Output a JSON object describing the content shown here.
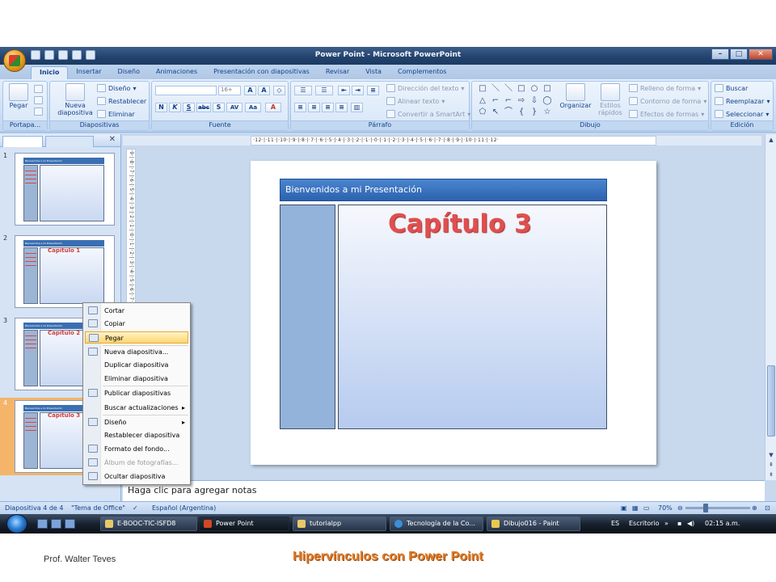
{
  "window": {
    "title": "Power Point - Microsoft PowerPoint"
  },
  "tabs": [
    "Inicio",
    "Insertar",
    "Diseño",
    "Animaciones",
    "Presentación con diapositivas",
    "Revisar",
    "Vista",
    "Complementos"
  ],
  "ribbon": {
    "clipboard": {
      "paste": "Pegar",
      "label": "Portapa..."
    },
    "slides": {
      "new_slide_1": "Nueva",
      "new_slide_2": "diapositiva",
      "layout": "Diseño",
      "reset": "Restablecer",
      "delete": "Eliminar",
      "label": "Diapositivas"
    },
    "font": {
      "size": "16+",
      "label": "Fuente",
      "bold": "N",
      "italic": "K",
      "underline": "S",
      "strike": "abc",
      "shadow": "S",
      "spacing": "AV",
      "case": "Aa",
      "color": "A"
    },
    "paragraph": {
      "text_direction": "Dirección del texto",
      "align_text": "Alinear texto",
      "smartart": "Convertir a SmartArt",
      "label": "Párrafo"
    },
    "drawing": {
      "shapes": [
        "□",
        "＼",
        "＼",
        "□",
        "○",
        "□",
        "△",
        "⌐",
        "⌐",
        "⇨",
        "⇩",
        "◯",
        "⬠",
        "↖",
        "⌒",
        "{",
        "}",
        "☆"
      ],
      "arrange": "Organizar",
      "quick_styles_1": "Estilos",
      "quick_styles_2": "rápidos",
      "fill": "Relleno de forma",
      "outline": "Contorno de forma",
      "effects": "Efectos de formas",
      "label": "Dibujo"
    },
    "editing": {
      "find": "Buscar",
      "replace": "Reemplazar",
      "select": "Seleccionar",
      "label": "Edición"
    }
  },
  "thumbnails": [
    {
      "num": "1",
      "header": "Bienvenidos a mi Presentación",
      "caption": ""
    },
    {
      "num": "2",
      "header": "Bienvenidos a mi Presentación",
      "caption": "Capítulo 1"
    },
    {
      "num": "3",
      "header": "Bienvenidos a mi Presentación",
      "caption": "Capítulo 2"
    },
    {
      "num": "4",
      "header": "Bienvenidos a mi Presentación",
      "caption": "Capítulo 3"
    }
  ],
  "ruler": {
    "horizontal": "·12·|·11·|·10·|·9·|·8·|·7·|·6·|·5·|·4·|·3·|·2·|·1·|·0·|·1·|·2·|·3·|·4·|·5·|·6·|·7·|·8·|·9·|·10·|·11·|·12·",
    "vertical": "·9·|·8·|·7·|·6·|·5·|·4·|·3·|·2·|·1·|·0·|·1·|·2·|·3·|·4·|·5·|·6·|·7·|·8·|·9·"
  },
  "slide": {
    "header": "Bienvenidos a mi Presentación",
    "caption": "Capítulo 3"
  },
  "notes": {
    "placeholder": "Haga clic para agregar notas"
  },
  "context_menu": [
    {
      "label": "Cortar",
      "icon": "scissors-icon",
      "highlighted": false,
      "disabled": false,
      "submenu": false
    },
    {
      "label": "Copiar",
      "icon": "copy-icon",
      "highlighted": false,
      "disabled": false,
      "submenu": false
    },
    {
      "label": "Pegar",
      "icon": "paste-icon",
      "highlighted": true,
      "disabled": false,
      "submenu": false
    },
    {
      "label": "Nueva diapositiva...",
      "icon": "new-slide-icon",
      "highlighted": false,
      "disabled": false,
      "submenu": false
    },
    {
      "label": "Duplicar diapositiva",
      "icon": "",
      "highlighted": false,
      "disabled": false,
      "submenu": false
    },
    {
      "label": "Eliminar diapositiva",
      "icon": "",
      "highlighted": false,
      "disabled": false,
      "submenu": false
    },
    {
      "label": "Publicar diapositivas",
      "icon": "publish-icon",
      "highlighted": false,
      "disabled": false,
      "submenu": false
    },
    {
      "label": "Buscar actualizaciones",
      "icon": "",
      "highlighted": false,
      "disabled": false,
      "submenu": true
    },
    {
      "label": "Diseño",
      "icon": "layout-icon",
      "highlighted": false,
      "disabled": false,
      "submenu": true
    },
    {
      "label": "Restablecer diapositiva",
      "icon": "",
      "highlighted": false,
      "disabled": false,
      "submenu": false
    },
    {
      "label": "Formato del fondo...",
      "icon": "format-background-icon",
      "highlighted": false,
      "disabled": false,
      "submenu": false
    },
    {
      "label": "Álbum de fotografías...",
      "icon": "photo-album-icon",
      "highlighted": false,
      "disabled": true,
      "submenu": false
    },
    {
      "label": "Ocultar diapositiva",
      "icon": "hide-slide-icon",
      "highlighted": false,
      "disabled": false,
      "submenu": false
    }
  ],
  "status": {
    "slide_count": "Diapositiva 4 de 4",
    "theme": "\"Tema de Office\"",
    "language": "Español (Argentina)",
    "zoom": "70%"
  },
  "taskbar": {
    "tasks": [
      "E-BOOC-TIC-ISFD8",
      "Power Point",
      "tutorialpp",
      "Tecnología de la Co...",
      "Dibujo016 - Paint"
    ],
    "lang": "ES",
    "desktop": "Escritorio",
    "clock": "02:15 a.m."
  },
  "footer": {
    "author": "Prof. Walter Teves",
    "title": "Hipervínculos con Power Point"
  }
}
